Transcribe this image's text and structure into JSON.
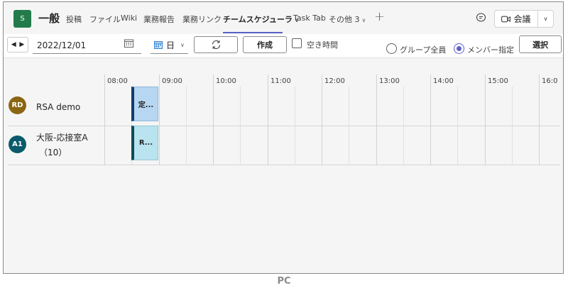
{
  "header": {
    "team_avatar": "S",
    "channel_name": "一般",
    "tabs": [
      {
        "label": "投稿"
      },
      {
        "label": "ファイル"
      },
      {
        "label": "Wiki"
      },
      {
        "label": "業務報告"
      },
      {
        "label": "業務リンク"
      },
      {
        "label": "チームスケジューラ",
        "active": true,
        "has_dropdown": true
      },
      {
        "label": "Task Tab"
      },
      {
        "label": "その他 3",
        "has_dropdown": true
      }
    ],
    "add_tab_icon": "plus-icon",
    "meet_label": "会議"
  },
  "toolbar": {
    "date_value": "2022/12/01",
    "view_value": "日",
    "create_label": "作成",
    "free_time_label": "空き時間",
    "group_all_label": "グループ全員",
    "member_select_label": "メンバー指定",
    "member_select_checked": true,
    "select_label": "選択"
  },
  "schedule": {
    "hours": [
      "08:00",
      "09:00",
      "10:00",
      "11:00",
      "12:00",
      "13:00",
      "14:00",
      "15:00",
      "16:0"
    ],
    "members": [
      {
        "initials": "RD",
        "name_lines": [
          "RSA demo"
        ],
        "avatar_color": "#8a6512",
        "event_label": "定...",
        "event_style": "blue"
      },
      {
        "initials": "A1",
        "name_lines": [
          "大阪-応接室A",
          "（10）"
        ],
        "avatar_color": "#0b5a6b",
        "event_label": "R...",
        "event_style": "teal"
      }
    ]
  },
  "footer_label": "PC",
  "colors": {
    "accent": "#5b5fc7",
    "team_green": "#237b4b"
  }
}
